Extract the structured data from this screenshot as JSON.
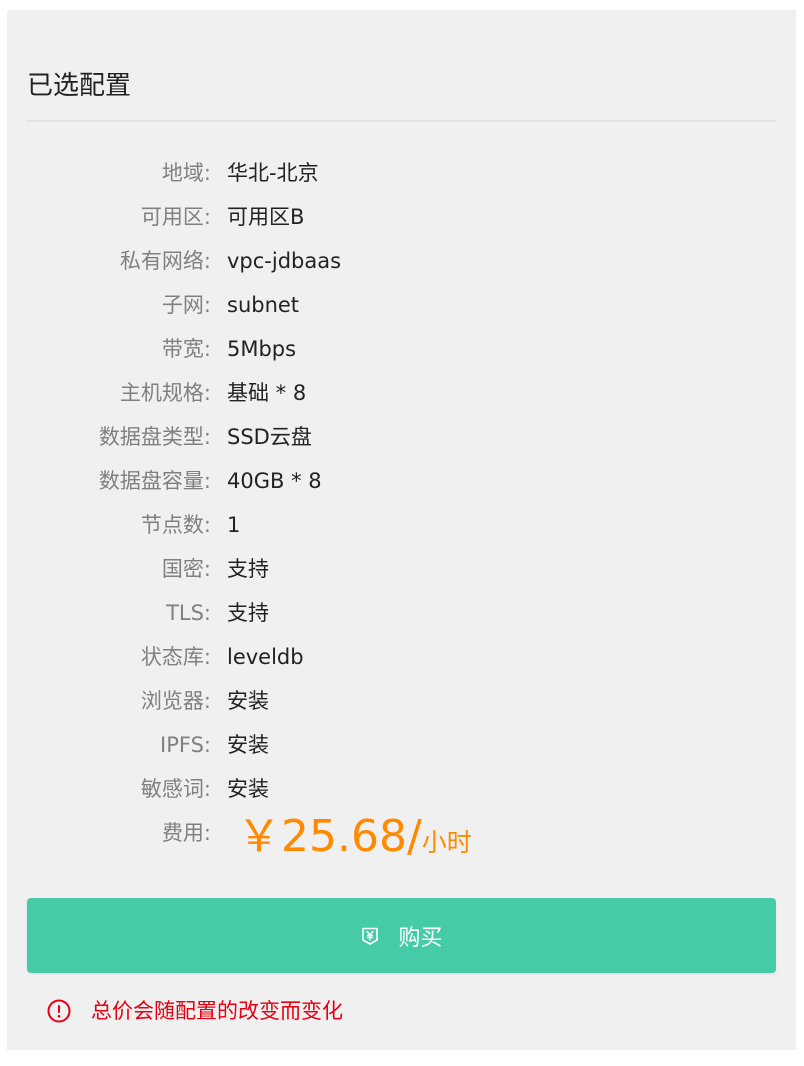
{
  "panel": {
    "title": "已选配置"
  },
  "specs": [
    {
      "label": "地域:",
      "value": "华北-北京"
    },
    {
      "label": "可用区:",
      "value": "可用区B"
    },
    {
      "label": "私有网络:",
      "value": "vpc-jdbaas"
    },
    {
      "label": "子网:",
      "value": "subnet"
    },
    {
      "label": "带宽:",
      "value": "5Mbps"
    },
    {
      "label": "主机规格:",
      "value": "基础 * 8"
    },
    {
      "label": "数据盘类型:",
      "value": "SSD云盘"
    },
    {
      "label": "数据盘容量:",
      "value": "40GB * 8"
    },
    {
      "label": "节点数:",
      "value": "1"
    },
    {
      "label": "国密:",
      "value": "支持"
    },
    {
      "label": "TLS:",
      "value": "支持"
    },
    {
      "label": "状态库:",
      "value": "leveldb"
    },
    {
      "label": "浏览器:",
      "value": "安装"
    },
    {
      "label": "IPFS:",
      "value": "安装"
    },
    {
      "label": "敏感词:",
      "value": "安装"
    }
  ],
  "price": {
    "label": "费用:",
    "amount": "￥25.68/",
    "unit": "小时"
  },
  "buy_button": {
    "label": "购买",
    "icon": "yen-tag-icon"
  },
  "notice": {
    "icon": "alert-circle-icon",
    "text": "总价会随配置的改变而变化"
  },
  "colors": {
    "accent": "#45cba8",
    "price": "#ff8a00",
    "warning": "#e60012"
  }
}
